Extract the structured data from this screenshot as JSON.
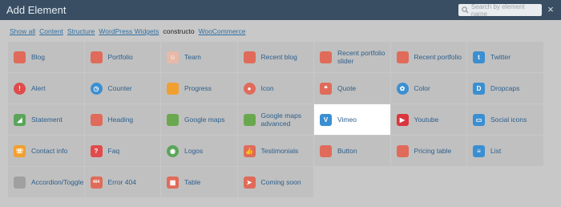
{
  "header": {
    "title": "Add Element",
    "search_placeholder": "Search by element name",
    "close": "×"
  },
  "filters": [
    {
      "label": "Show all",
      "linked": true
    },
    {
      "label": "Content",
      "linked": true
    },
    {
      "label": "Structure",
      "linked": true
    },
    {
      "label": "WordPress Widgets",
      "linked": true
    },
    {
      "label": "constructo",
      "linked": false
    },
    {
      "label": "WooCommerce",
      "linked": true
    }
  ],
  "elements": [
    {
      "label": "Blog",
      "icon": "blog-icon",
      "color": "#e06b5a"
    },
    {
      "label": "Portfolio",
      "icon": "portfolio-icon",
      "color": "#e06b5a"
    },
    {
      "label": "Team",
      "icon": "team-icon",
      "color": "#e8b8a8"
    },
    {
      "label": "Recent blog",
      "icon": "recent-blog-icon",
      "color": "#e06b5a"
    },
    {
      "label": "Recent portfolio slider",
      "icon": "recent-portfolio-slider-icon",
      "color": "#e06b5a"
    },
    {
      "label": "Recent portfolio",
      "icon": "recent-portfolio-icon",
      "color": "#e06b5a"
    },
    {
      "label": "Twitter",
      "icon": "twitter-icon",
      "color": "#3b8fd1"
    },
    {
      "label": "Alert",
      "icon": "alert-icon",
      "color": "#e04b4b"
    },
    {
      "label": "Counter",
      "icon": "counter-icon",
      "color": "#3b8fd1"
    },
    {
      "label": "Progress",
      "icon": "progress-icon",
      "color": "#f0a030"
    },
    {
      "label": "Icon",
      "icon": "icon-icon",
      "color": "#e06b5a"
    },
    {
      "label": "Quote",
      "icon": "quote-icon",
      "color": "#e06b5a"
    },
    {
      "label": "Color",
      "icon": "color-icon",
      "color": "#3b8fd1"
    },
    {
      "label": "Dropcaps",
      "icon": "dropcaps-icon",
      "color": "#3b8fd1"
    },
    {
      "label": "Statement",
      "icon": "statement-icon",
      "color": "#5aa55a"
    },
    {
      "label": "Heading",
      "icon": "heading-icon",
      "color": "#e06b5a"
    },
    {
      "label": "Google maps",
      "icon": "google-maps-icon",
      "color": "#6aa84f"
    },
    {
      "label": "Google maps advanced",
      "icon": "google-maps-advanced-icon",
      "color": "#6aa84f"
    },
    {
      "label": "Vimeo",
      "icon": "vimeo-icon",
      "color": "#3b8fd1",
      "highlighted": true
    },
    {
      "label": "Youtube",
      "icon": "youtube-icon",
      "color": "#d9363e"
    },
    {
      "label": "Social icons",
      "icon": "social-icons-icon",
      "color": "#3b8fd1"
    },
    {
      "label": "Contact info",
      "icon": "contact-info-icon",
      "color": "#f0a030"
    },
    {
      "label": "Faq",
      "icon": "faq-icon",
      "color": "#e04b4b"
    },
    {
      "label": "Logos",
      "icon": "logos-icon",
      "color": "#5aa55a"
    },
    {
      "label": "Testimonials",
      "icon": "testimonials-icon",
      "color": "#e06b5a"
    },
    {
      "label": "Button",
      "icon": "button-icon",
      "color": "#e06b5a"
    },
    {
      "label": "Pricing table",
      "icon": "pricing-table-icon",
      "color": "#e06b5a"
    },
    {
      "label": "List",
      "icon": "list-icon",
      "color": "#3b8fd1"
    },
    {
      "label": "Accordion/Toggle",
      "icon": "accordion-toggle-icon",
      "color": "#a0a0a0"
    },
    {
      "label": "Error 404",
      "icon": "error-404-icon",
      "color": "#e06b5a"
    },
    {
      "label": "Table",
      "icon": "table-icon",
      "color": "#e06b5a"
    },
    {
      "label": "Coming soon",
      "icon": "coming-soon-icon",
      "color": "#e06b5a"
    }
  ]
}
